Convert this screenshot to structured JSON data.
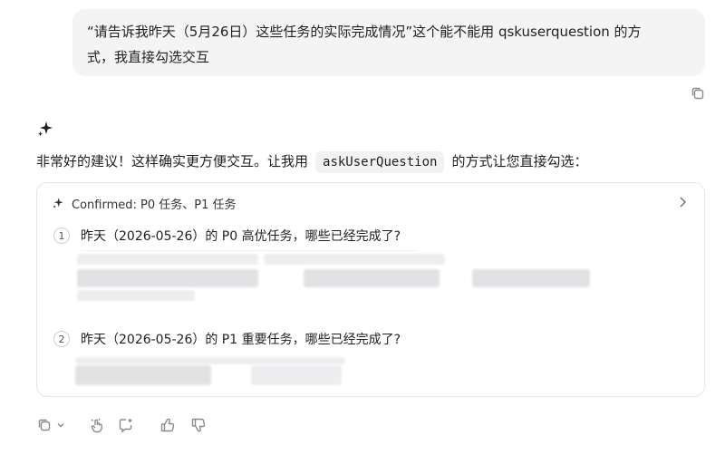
{
  "user_message": {
    "line1": "“请告诉我昨天（5月26日）这些任务的实际完成情况”这个能不能用 qskuserquestion 的方",
    "line2": "式，我直接勾选交互"
  },
  "assistant": {
    "text_before": "非常好的建议！这样确实更方便交互。让我用",
    "code": "askUserQuestion",
    "text_after": "的方式让您直接勾选："
  },
  "card": {
    "header": "Confirmed: P0 任务、P1 任务",
    "questions": [
      {
        "number": "1",
        "text": "昨天（2026-05-26）的 P0 高优任务，哪些已经完成了?"
      },
      {
        "number": "2",
        "text": "昨天（2026-05-26）的 P1 重要任务，哪些已经完成了?"
      }
    ]
  },
  "icons": {
    "copy": "copy-icon",
    "sparkle": "sparkle-icon",
    "chevron": "chevron-right-icon",
    "actions": [
      "copy-icon",
      "chevron-down-icon",
      "touch-icon",
      "add-comment-icon",
      "thumbs-up-icon",
      "thumbs-down-icon"
    ]
  },
  "colors": {
    "bubble_bg": "#f4f4f5",
    "border": "#e6e6e8",
    "icon": "#8a8a8e"
  }
}
